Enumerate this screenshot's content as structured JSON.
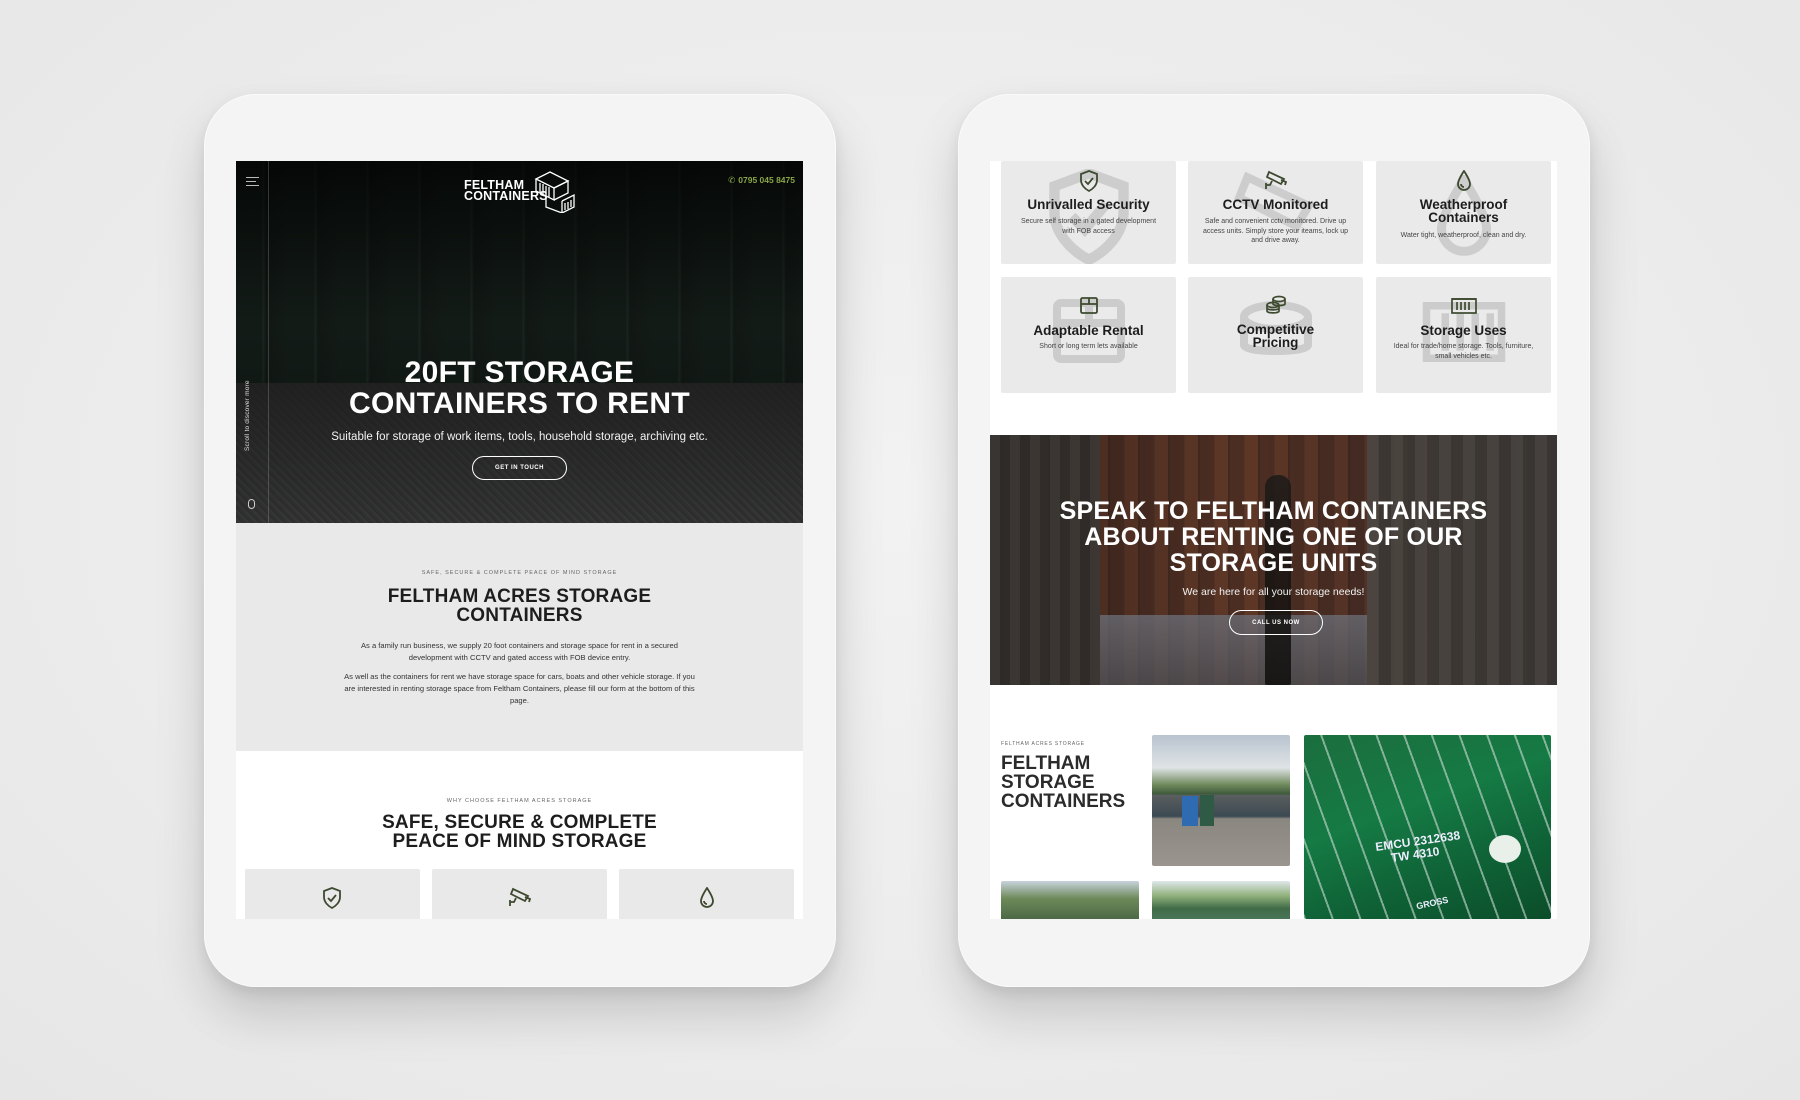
{
  "left_screen": {
    "header": {
      "menu_icon": "hamburger-menu-icon",
      "logo_line1": "FELTHAM",
      "logo_line2": "CONTAINERS",
      "phone_icon": "phone-icon",
      "phone": "0795 045 8475",
      "accent_color": "#8aa54a"
    },
    "hero": {
      "title_line1": "20FT STORAGE",
      "title_line2": "CONTAINERS TO RENT",
      "subtitle": "Suitable for storage of work items, tools, household storage, archiving etc.",
      "button": "GET IN TOUCH",
      "scroll_hint": "Scroll to discover more"
    },
    "about": {
      "eyebrow": "SAFE, SECURE & COMPLETE PEACE OF MIND STORAGE",
      "title_line1": "FELTHAM ACRES STORAGE",
      "title_line2": "CONTAINERS",
      "paragraph1": "As a family run business, we supply 20 foot containers and storage space for rent in a secured development with CCTV and gated access with FOB device entry.",
      "paragraph2": "As well as the containers for rent we have storage space for cars, boats and other vehicle storage. If you are interested in renting storage space from Feltham Containers, please fill our form at the bottom of this page."
    },
    "why": {
      "eyebrow": "WHY CHOOSE FELTHAM ACRES STORAGE",
      "title_line1": "SAFE, SECURE & COMPLETE",
      "title_line2": "PEACE OF MIND STORAGE",
      "card_icons": [
        "shield-check-icon",
        "cctv-camera-icon",
        "water-drop-icon"
      ]
    }
  },
  "right_screen": {
    "features": [
      {
        "icon": "shield-check-icon",
        "title": "Unrivalled Security",
        "desc": "Secure self storage in a gated development with FOB access"
      },
      {
        "icon": "cctv-camera-icon",
        "title": "CCTV Monitored",
        "desc": "Safe and convenient cctv monitored. Drive up access units. Simply store your iteams, lock up and drive away."
      },
      {
        "icon": "water-drop-icon",
        "title_line1": "Weatherproof",
        "title_line2": "Containers",
        "desc": "Water tight, weatherproof, clean and dry."
      },
      {
        "icon": "box-icon",
        "title": "Adaptable Rental",
        "desc": "Short or long term lets available"
      },
      {
        "icon": "coins-icon",
        "title_line1": "Competitive",
        "title_line2": "Pricing",
        "desc": ""
      },
      {
        "icon": "container-icon",
        "title": "Storage Uses",
        "desc": "Ideal for trade/home storage. Tools, furniture, small vehicles etc."
      }
    ],
    "cta": {
      "title_line1": "SPEAK TO FELTHAM CONTAINERS",
      "title_line2": "ABOUT RENTING ONE OF OUR",
      "title_line3": "STORAGE UNITS",
      "subtitle": "We are here for all your storage needs!",
      "button": "CALL US NOW"
    },
    "gallery": {
      "eyebrow": "FELTHAM ACRES STORAGE",
      "title_line1": "FELTHAM",
      "title_line2": "STORAGE",
      "title_line3": "CONTAINERS",
      "container_code_line1": "EMCU 2312638",
      "container_code_line2": "TW 4310",
      "container_label": "GROSS"
    }
  },
  "colors": {
    "icon_green": "#3d4a2f",
    "card_bg": "#eaeaea",
    "about_bg": "#e9e9e9"
  }
}
